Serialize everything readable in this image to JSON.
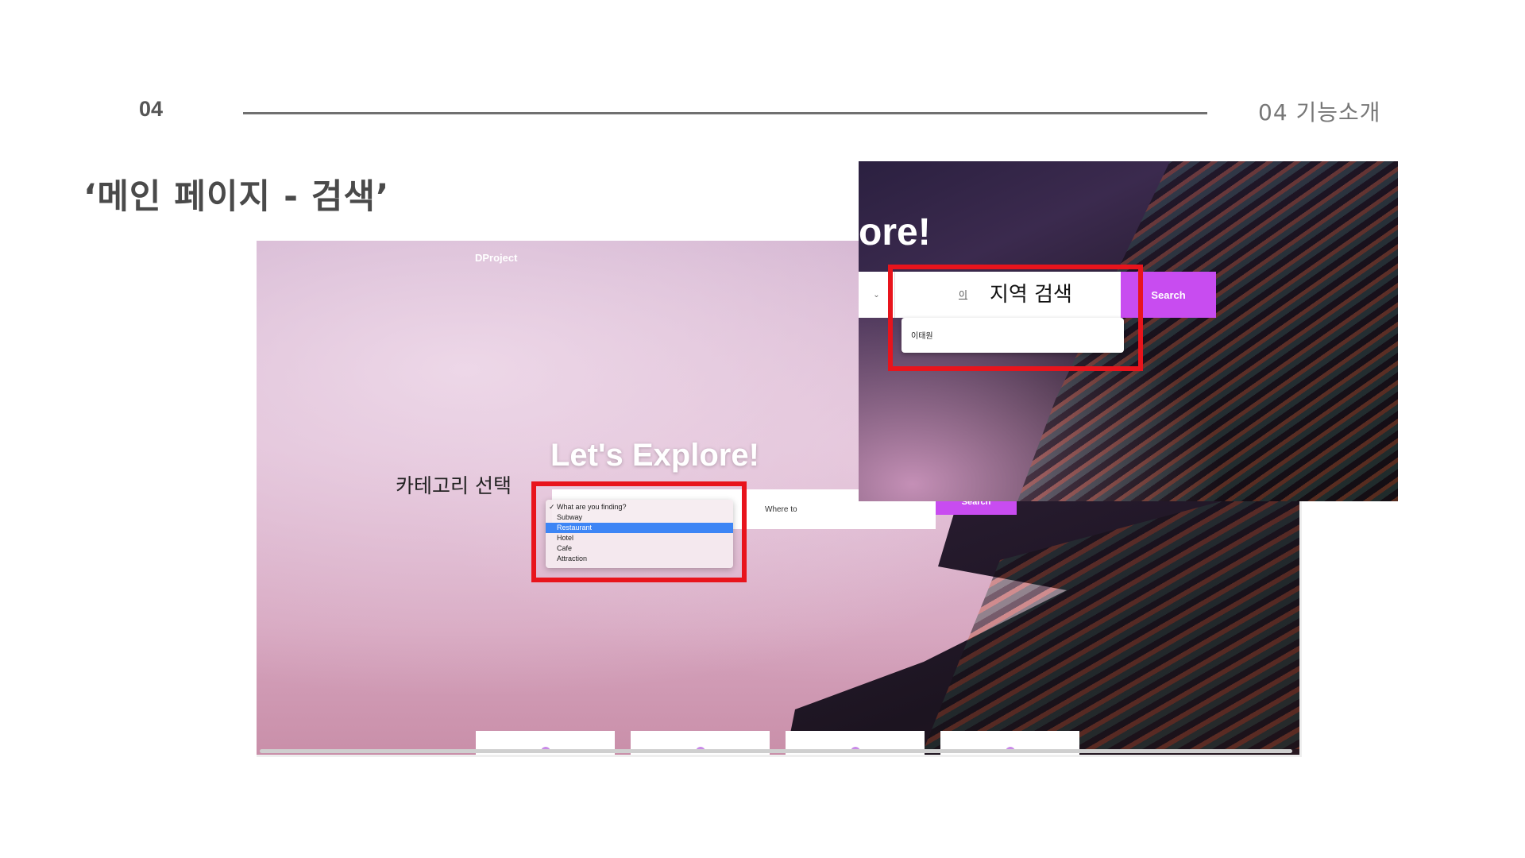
{
  "slide": {
    "number": "04",
    "section_label": "04  기능소개",
    "title": "‘메인 페이지 - 검색’"
  },
  "main_screenshot": {
    "brand": "DProject",
    "hero_title": "Let's Explore!",
    "category_dropdown": {
      "options": [
        "What are you finding?",
        "Subway",
        "Restaurant",
        "Hotel",
        "Cafe",
        "Attraction"
      ],
      "checked": "What are you finding?",
      "highlighted": "Restaurant"
    },
    "where_placeholder": "Where to",
    "search_label": "Search",
    "feature_card_count": 4
  },
  "zoom_screenshot": {
    "hero_title_fragment": "ore!",
    "typed_text": "이",
    "search_label": "Search",
    "suggestion": "이태원"
  },
  "annotations": {
    "category": "카테고리 선택",
    "region": "지역 검색"
  },
  "colors": {
    "accent": "#c84cf0",
    "highlight_box": "#e8141c",
    "selected_option": "#3d85f5"
  }
}
